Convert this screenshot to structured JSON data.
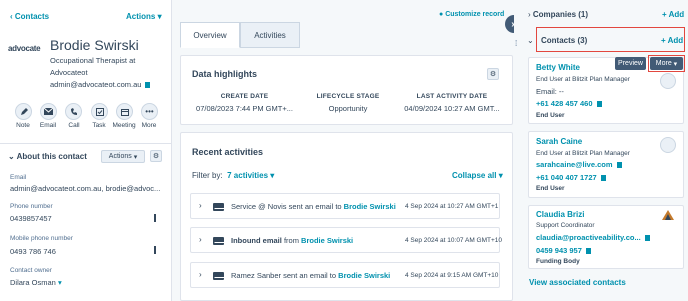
{
  "left": {
    "back_label": "Contacts",
    "actions_label": "Actions",
    "company_logo_text": "advocate",
    "name": "Brodie Swirski",
    "title_line1": "Occupational Therapist at",
    "title_line2": "Advocateot",
    "email": "admin@advocateot.com.au",
    "quick_actions": [
      "Note",
      "Email",
      "Call",
      "Task",
      "Meeting",
      "More"
    ],
    "about_title": "About this contact",
    "about_actions_label": "Actions",
    "fields": [
      {
        "label": "Email",
        "value": "admin@advocateot.com.au, brodie@advoc..."
      },
      {
        "label": "Phone number",
        "value": "0439857457"
      },
      {
        "label": "Mobile phone number",
        "value": "0493 786 746"
      },
      {
        "label": "Contact owner",
        "value": "Dilara Osman"
      }
    ]
  },
  "middle": {
    "customize_label": "Customize record",
    "tabs": [
      "Overview",
      "Activities"
    ],
    "highlights": {
      "title": "Data highlights",
      "columns": [
        {
          "header": "CREATE DATE",
          "value": "07/08/2023 7:44 PM GMT+..."
        },
        {
          "header": "LIFECYCLE STAGE",
          "value": "Opportunity"
        },
        {
          "header": "LAST ACTIVITY DATE",
          "value": "04/09/2024 10:27 AM GMT..."
        }
      ]
    },
    "recent": {
      "title": "Recent activities",
      "filter_prefix": "Filter by:",
      "filter_value": "7 activities",
      "collapse_label": "Collapse all",
      "items": [
        {
          "prefix": "Service @ Novis sent an email to",
          "name": "Brodie Swirski",
          "date": "4 Sep 2024 at 10:27 AM GMT+1"
        },
        {
          "prefix": "Inbound email",
          "mid": "from",
          "name": "Brodie Swirski",
          "date": "4 Sep 2024 at 10:07 AM GMT+10"
        },
        {
          "prefix": "Ramez Sanber sent an email to",
          "name": "Brodie Swirski",
          "date": "4 Sep 2024 at 9:15 AM GMT+10"
        }
      ]
    }
  },
  "right": {
    "companies_label": "Companies (1)",
    "companies_add": "+ Add",
    "contacts_label": "Contacts (3)",
    "contacts_add": "+ Add",
    "preview_label": "Preview",
    "more_label": "More",
    "contacts": [
      {
        "name": "Betty White",
        "role": "End User at Blitzit Plan Manager",
        "email": "Email: --",
        "phone": "+61 428 457 460",
        "tag": "End User"
      },
      {
        "name": "Sarah Caine",
        "role": "End User at Blitzit Plan Manager",
        "email": "sarahcaine@live.com",
        "phone": "+61 040 407 1727",
        "tag": "End User"
      },
      {
        "name": "Claudia Brizi",
        "role": "Support Coordinator",
        "email": "claudia@proactiveability.co...",
        "phone": "0459 943 957",
        "tag": "Funding Body"
      }
    ],
    "view_associated": "View associated contacts"
  },
  "colors": {
    "accent": "#0091ae",
    "highlight_border": "#e2473f",
    "preview_bg": "#425b76"
  }
}
